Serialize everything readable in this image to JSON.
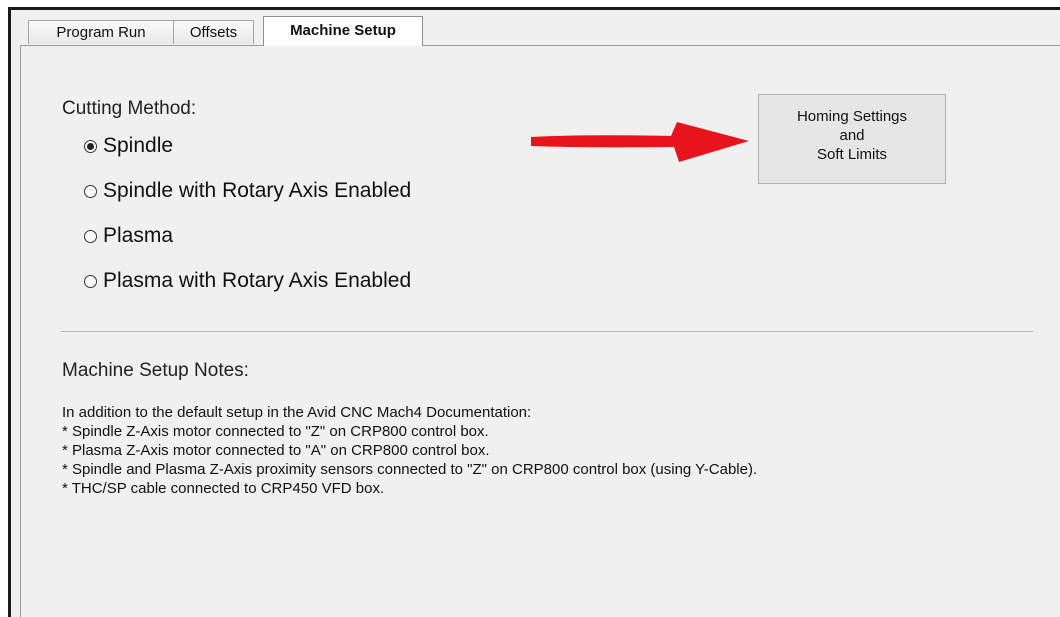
{
  "tabs": [
    {
      "label": "Program Run"
    },
    {
      "label": "Offsets"
    },
    {
      "label": "Machine Setup",
      "active": true
    }
  ],
  "cutting_method": {
    "label": "Cutting Method:",
    "options": [
      {
        "label": "Spindle",
        "selected": true
      },
      {
        "label": "Spindle with Rotary Axis Enabled",
        "selected": false
      },
      {
        "label": "Plasma",
        "selected": false
      },
      {
        "label": "Plasma with Rotary Axis Enabled",
        "selected": false
      }
    ]
  },
  "homing_button": {
    "line1": "Homing Settings",
    "line2": "and",
    "line3": "Soft Limits"
  },
  "notes": {
    "heading": "Machine Setup Notes:",
    "lines": [
      "In addition to the default setup in the Avid CNC Mach4 Documentation:",
      "* Spindle Z-Axis motor connected to \"Z\" on CRP800 control box.",
      "* Plasma Z-Axis motor connected to \"A\" on CRP800 control box.",
      "* Spindle and Plasma Z-Axis proximity sensors connected to \"Z\" on CRP800 control box (using Y-Cable).",
      "* THC/SP cable connected to CRP450 VFD box."
    ]
  },
  "colors": {
    "arrow": "#e8141c",
    "background": "#f0f0f0"
  }
}
